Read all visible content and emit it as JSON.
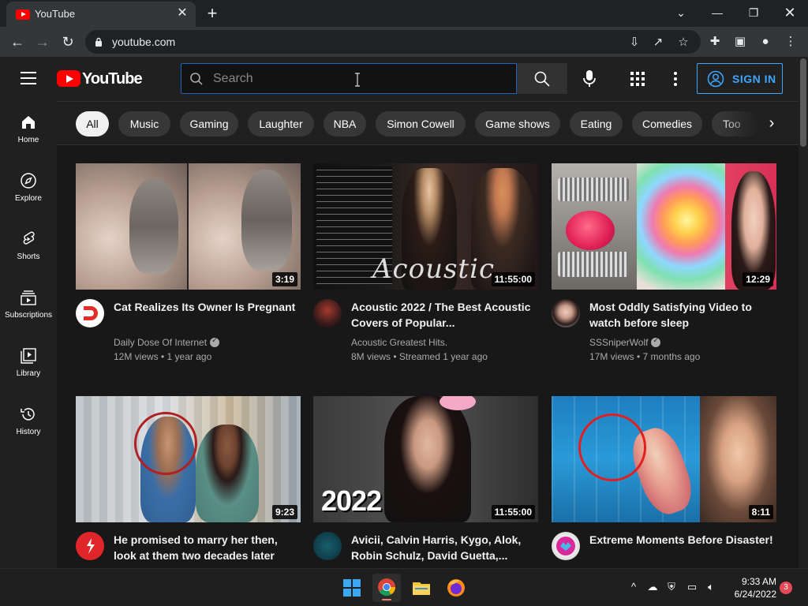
{
  "browser": {
    "tab_title": "YouTube",
    "url": "youtube.com"
  },
  "header": {
    "logo_text": "YouTube",
    "search_placeholder": "Search",
    "signin_label": "SIGN IN"
  },
  "chips": [
    "All",
    "Music",
    "Gaming",
    "Laughter",
    "NBA",
    "Simon Cowell",
    "Game shows",
    "Eating",
    "Comedies",
    "Too"
  ],
  "sidebar": [
    {
      "label": "Home",
      "icon": "home-icon"
    },
    {
      "label": "Explore",
      "icon": "compass-icon"
    },
    {
      "label": "Shorts",
      "icon": "shorts-icon"
    },
    {
      "label": "Subscriptions",
      "icon": "subscriptions-icon"
    },
    {
      "label": "Library",
      "icon": "library-icon"
    },
    {
      "label": "History",
      "icon": "history-icon"
    }
  ],
  "videos": [
    {
      "title": "Cat Realizes Its Owner Is Pregnant",
      "channel": "Daily Dose Of Internet",
      "verified": true,
      "meta": "12M views • 1 year ago",
      "duration": "3:19"
    },
    {
      "title": "Acoustic 2022 / The Best Acoustic Covers of Popular...",
      "channel": "Acoustic Greatest Hits.",
      "verified": false,
      "meta": "8M views • Streamed 1 year ago",
      "duration": "11:55:00",
      "thumb_text": "Acoustic"
    },
    {
      "title": "Most Oddly Satisfying Video to watch before sleep",
      "channel": "SSSniperWolf",
      "verified": true,
      "meta": "17M views • 7 months ago",
      "duration": "12:29"
    },
    {
      "title": "He promised to marry her then, look at them two decades later",
      "channel": "",
      "verified": false,
      "meta": "",
      "duration": "9:23"
    },
    {
      "title": "Avicii, Calvin Harris, Kygo, Alok, Robin Schulz, David Guetta,...",
      "channel": "",
      "verified": false,
      "meta": "",
      "duration": "11:55:00",
      "thumb_text": "2022"
    },
    {
      "title": "Extreme Moments Before Disaster!",
      "channel": "",
      "verified": false,
      "meta": "",
      "duration": "8:11"
    }
  ],
  "taskbar": {
    "time": "9:33 AM",
    "date": "6/24/2022",
    "notifications": "3"
  }
}
